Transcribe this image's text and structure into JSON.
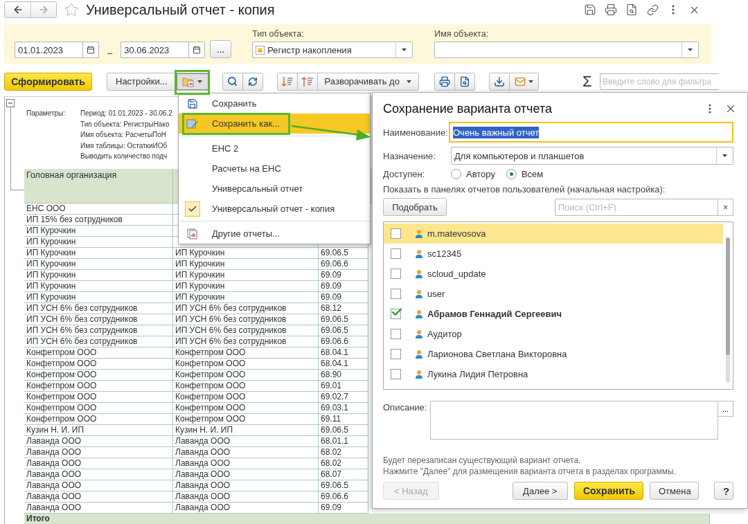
{
  "window": {
    "title": "Универсальный отчет - копия",
    "favorite": false
  },
  "filters": {
    "date_from": "01.01.2023",
    "dash": "–",
    "date_to": "30.06.2023",
    "period_button": "...",
    "object_type": {
      "label": "Тип объекта:",
      "value": "Регистр накопления"
    },
    "object_name": {
      "label": "Имя объекта:"
    }
  },
  "toolbar": {
    "generate": "Сформировать",
    "settings": "Настройки...",
    "expand": "Разворачивать до",
    "sum": "Σ",
    "filter_placeholder": "Введите слово для фильтра"
  },
  "report": {
    "params_label": "Параметры:",
    "params": [
      "Период: 01.01.2023 - 30.06.2",
      "Тип объекта: РегистрыНако",
      "Имя объекта: РасчетыПоН",
      "Имя таблицы: ОстаткиИОб",
      "Выводить количество подч"
    ],
    "columns": [
      "Головная организация"
    ],
    "rows": [
      [
        "ЕНС ООО"
      ],
      [
        "ИП 15% без сотрудников"
      ],
      [
        "ИП Курочкин"
      ],
      [
        "ИП Курочкин"
      ],
      [
        "ИП Курочкин",
        "ИП Курочкин",
        "69.06.5"
      ],
      [
        "ИП Курочкин",
        "ИП Курочкин",
        "69.06.6"
      ],
      [
        "ИП Курочкин",
        "ИП Курочкин",
        "69.09"
      ],
      [
        "ИП Курочкин",
        "ИП Курочкин",
        "69.09"
      ],
      [
        "ИП Курочкин",
        "ИП Курочкин",
        "69.09"
      ],
      [
        "ИП УСН 6% без сотрудников",
        "ИП УСН 6% без сотрудников",
        "68.12"
      ],
      [
        "ИП УСН 6% без сотрудников",
        "ИП УСН 6% без сотрудников",
        "69.06.5"
      ],
      [
        "ИП УСН 6% без сотрудников",
        "ИП УСН 6% без сотрудников",
        "69.06.5"
      ],
      [
        "ИП УСН 6% без сотрудников",
        "ИП УСН 6% без сотрудников",
        "69.06.6"
      ],
      [
        "Конфетпром ООО",
        "Конфетпром ООО",
        "68.04.1"
      ],
      [
        "Конфетпром ООО",
        "Конфетпром ООО",
        "68.04.1"
      ],
      [
        "Конфетпром ООО",
        "Конфетпром ООО",
        "68.90"
      ],
      [
        "Конфетпром ООО",
        "Конфетпром ООО",
        "69.01"
      ],
      [
        "Конфетпром ООО",
        "Конфетпром ООО",
        "69.02.7"
      ],
      [
        "Конфетпром ООО",
        "Конфетпром ООО",
        "69.03.1"
      ],
      [
        "Конфетпром ООО",
        "Конфетпром ООО",
        "69.11"
      ],
      [
        "Кузин Н. И. ИП",
        "Кузин Н. И. ИП",
        "69.06.5"
      ],
      [
        "Лаванда ООО",
        "Лаванда ООО",
        "68.01.1"
      ],
      [
        "Лаванда ООО",
        "Лаванда ООО",
        "68.02"
      ],
      [
        "Лаванда ООО",
        "Лаванда ООО",
        "68.02"
      ],
      [
        "Лаванда ООО",
        "Лаванда ООО",
        "68.07"
      ],
      [
        "Лаванда ООО",
        "Лаванда ООО",
        "69.06.5"
      ],
      [
        "Лаванда ООО",
        "Лаванда ООО",
        "69.06.6"
      ],
      [
        "Лаванда ООО",
        "Лаванда ООО",
        "69.09"
      ]
    ],
    "total": "Итого"
  },
  "menu": {
    "items": [
      {
        "kind": "save",
        "label": "Сохранить",
        "highlighted": false
      },
      {
        "kind": "save_as",
        "label": "Сохранить как...",
        "highlighted": true
      },
      {
        "kind": "separator"
      },
      {
        "kind": "variant",
        "label": "ЕНС 2",
        "highlighted": false,
        "checked": false
      },
      {
        "kind": "variant",
        "label": "Расчеты на ЕНС",
        "highlighted": false,
        "checked": false
      },
      {
        "kind": "variant",
        "label": "Универсальный отчет",
        "highlighted": false,
        "checked": false
      },
      {
        "kind": "variant",
        "label": "Универсальный отчет - копия",
        "highlighted": false,
        "checked": true
      },
      {
        "kind": "separator"
      },
      {
        "kind": "reports",
        "label": "Другие отчеты...",
        "highlighted": false
      }
    ]
  },
  "dialog": {
    "title": "Сохранение варианта отчета",
    "name_label": "Наименование:",
    "name_value": "Очень важный отчет",
    "purpose_label": "Назначение:",
    "purpose_value": "Для компьютеров и планшетов",
    "access_label": "Доступен:",
    "access_options": [
      {
        "label": "Автору",
        "selected": false
      },
      {
        "label": "Всем",
        "selected": true
      }
    ],
    "panels_label": "Показать в панелях отчетов пользователей (начальная настройка):",
    "pick_button": "Подобрать",
    "search_placeholder": "Поиск (Ctrl+F)",
    "search_clear": "×",
    "users": [
      {
        "name": "m.matevosova",
        "checked": false,
        "selected": true
      },
      {
        "name": "sc12345",
        "checked": false,
        "selected": false
      },
      {
        "name": "scloud_update",
        "checked": false,
        "selected": false
      },
      {
        "name": "user",
        "checked": false,
        "selected": false
      },
      {
        "name": "Абрамов Геннадий Сергеевич",
        "checked": true,
        "selected": false
      },
      {
        "name": "Аудитор",
        "checked": false,
        "selected": false
      },
      {
        "name": "Ларионова Светлана Викторовна",
        "checked": false,
        "selected": false
      },
      {
        "name": "Лукина Лидия Петровна",
        "checked": false,
        "selected": false
      }
    ],
    "description_label": "Описание:",
    "description_more": "...",
    "notes": [
      "Будет перезаписан существующий вариант отчета.",
      "Нажмите \"Далее\" для размещения варианта отчета в разделах программы."
    ],
    "buttons": [
      {
        "kind": "back",
        "label": "<  Назад",
        "disabled": true
      },
      {
        "kind": "next",
        "label": "Далее  >",
        "disabled": false
      },
      {
        "kind": "primary",
        "label": "Сохранить",
        "disabled": false
      },
      {
        "kind": "cancel",
        "label": "Отмена",
        "disabled": false
      },
      {
        "kind": "help",
        "label": "?",
        "disabled": false
      }
    ]
  }
}
